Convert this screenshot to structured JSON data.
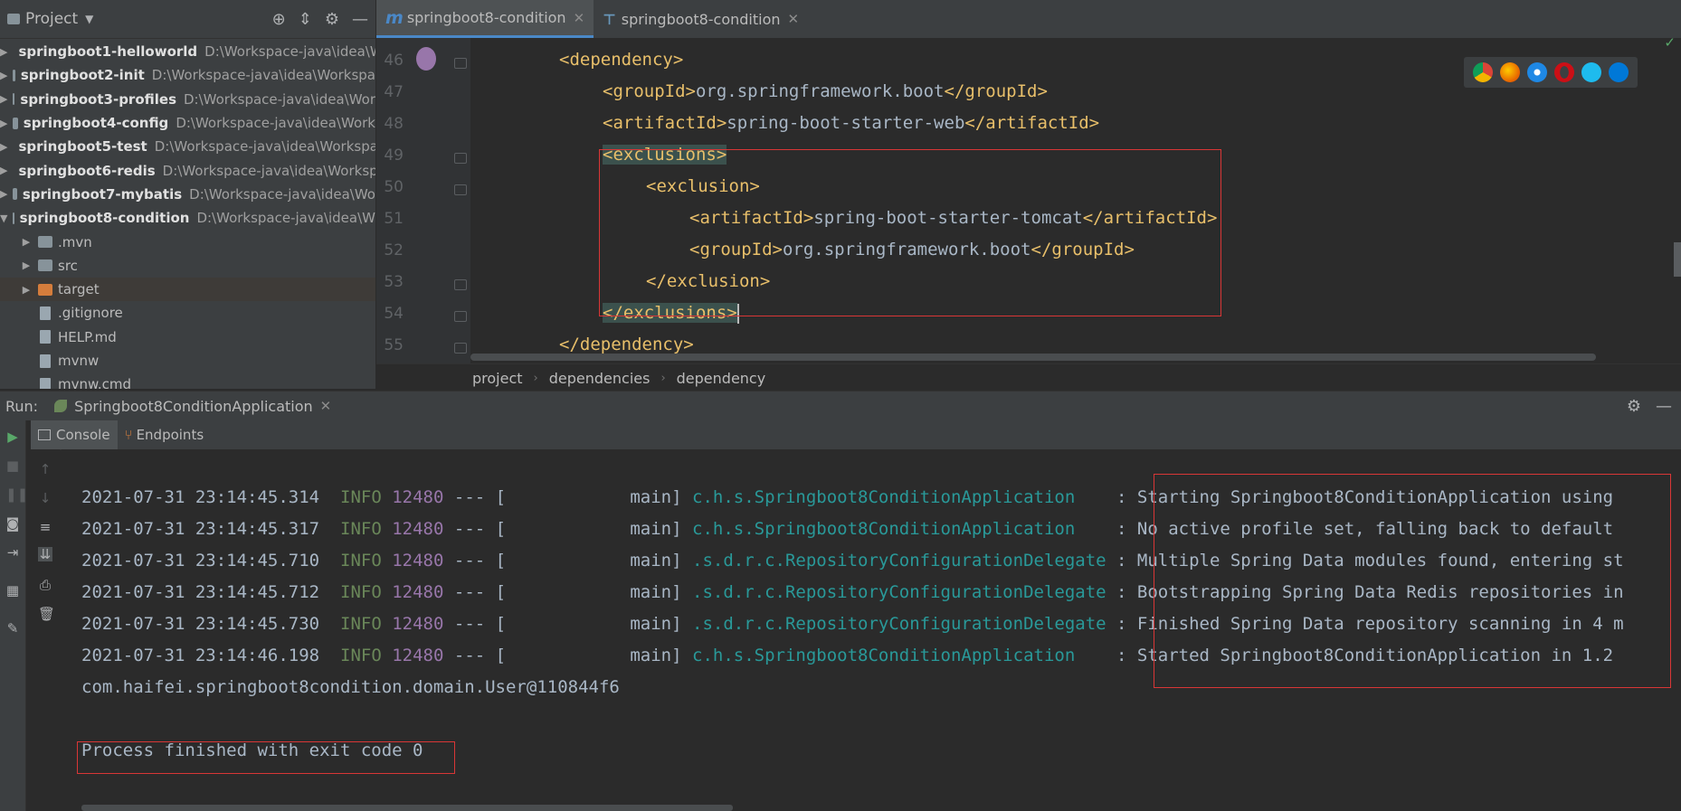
{
  "project_panel": {
    "title": "Project",
    "modules": [
      {
        "name": "springboot1-helloworld",
        "path": "D:\\Workspace-java\\idea\\W"
      },
      {
        "name": "springboot2-init",
        "path": "D:\\Workspace-java\\idea\\Workspa"
      },
      {
        "name": "springboot3-profiles",
        "path": "D:\\Workspace-java\\idea\\Wor"
      },
      {
        "name": "springboot4-config",
        "path": "D:\\Workspace-java\\idea\\Work"
      },
      {
        "name": "springboot5-test",
        "path": "D:\\Workspace-java\\idea\\Workspa"
      },
      {
        "name": "springboot6-redis",
        "path": "D:\\Workspace-java\\idea\\Worksp"
      },
      {
        "name": "springboot7-mybatis",
        "path": "D:\\Workspace-java\\idea\\Wo"
      },
      {
        "name": "springboot8-condition",
        "path": "D:\\Workspace-java\\idea\\W"
      }
    ],
    "children": [
      ".mvn",
      "src",
      "target",
      ".gitignore",
      "HELP.md",
      "mvnw",
      "mvnw.cmd"
    ]
  },
  "editor": {
    "tabs": [
      "springboot8-condition",
      "springboot8-condition"
    ],
    "line_numbers": [
      "46",
      "47",
      "48",
      "49",
      "50",
      "51",
      "52",
      "53",
      "54",
      "55"
    ],
    "lines": [
      {
        "open": "<dependency>"
      },
      {
        "open": "<groupId>",
        "text": "org.springframework.boot",
        "close": "</groupId>"
      },
      {
        "open": "<artifactId>",
        "text": "spring-boot-starter-web",
        "close": "</artifactId>"
      },
      {
        "open": "<exclusions>"
      },
      {
        "open": "<exclusion>"
      },
      {
        "open": "<artifactId>",
        "text": "spring-boot-starter-tomcat",
        "close": "</artifactId>"
      },
      {
        "open": "<groupId>",
        "text": "org.springframework.boot",
        "close": "</groupId>"
      },
      {
        "open": "</exclusion>"
      },
      {
        "open": "</exclusions>"
      },
      {
        "open": "</dependency>"
      }
    ],
    "breadcrumb": [
      "project",
      "dependencies",
      "dependency"
    ]
  },
  "run_panel": {
    "label": "Run:",
    "config_name": "Springboot8ConditionApplication",
    "subtabs": [
      "Console",
      "Endpoints"
    ],
    "log": [
      {
        "ts": "2021-07-31 23:14:45.314",
        "level": "INFO",
        "pid": "12480",
        "sep": "--- [",
        "thread": "main]",
        "logger": "c.h.s.Springboot8ConditionApplication",
        "msg": ": Starting Springboot8ConditionApplication using"
      },
      {
        "ts": "2021-07-31 23:14:45.317",
        "level": "INFO",
        "pid": "12480",
        "sep": "--- [",
        "thread": "main]",
        "logger": "c.h.s.Springboot8ConditionApplication",
        "msg": ": No active profile set, falling back to default"
      },
      {
        "ts": "2021-07-31 23:14:45.710",
        "level": "INFO",
        "pid": "12480",
        "sep": "--- [",
        "thread": "main]",
        "logger": ".s.d.r.c.RepositoryConfigurationDelegate",
        "msg": ": Multiple Spring Data modules found, entering st"
      },
      {
        "ts": "2021-07-31 23:14:45.712",
        "level": "INFO",
        "pid": "12480",
        "sep": "--- [",
        "thread": "main]",
        "logger": ".s.d.r.c.RepositoryConfigurationDelegate",
        "msg": ": Bootstrapping Spring Data Redis repositories in"
      },
      {
        "ts": "2021-07-31 23:14:45.730",
        "level": "INFO",
        "pid": "12480",
        "sep": "--- [",
        "thread": "main]",
        "logger": ".s.d.r.c.RepositoryConfigurationDelegate",
        "msg": ": Finished Spring Data repository scanning in 4 m"
      },
      {
        "ts": "2021-07-31 23:14:46.198",
        "level": "INFO",
        "pid": "12480",
        "sep": "--- [",
        "thread": "main]",
        "logger": "c.h.s.Springboot8ConditionApplication",
        "msg": ": Started Springboot8ConditionApplication in 1.2"
      }
    ],
    "output_line": "com.haifei.springboot8condition.domain.User@110844f6",
    "exit_line": "Process finished with exit code 0"
  },
  "colors": {
    "highlight_box": "#d93636",
    "info": "#6a8759",
    "pid": "#9876aa",
    "logger": "#299999",
    "xml_tag": "#e8bf6a"
  }
}
